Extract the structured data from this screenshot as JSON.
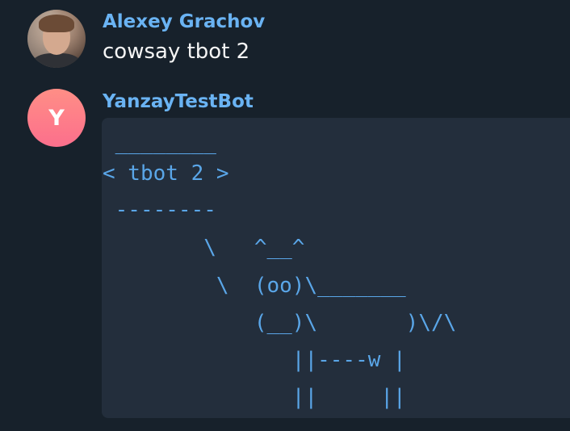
{
  "messages": [
    {
      "sender": "Alexey Grachov",
      "text": "cowsay tbot 2",
      "avatar": {
        "type": "photo",
        "icon": "user-photo-avatar"
      }
    },
    {
      "sender": "YanzayTestBot",
      "avatar": {
        "type": "letter",
        "letter": "Y",
        "colors": [
          "#ff8e86",
          "#fc6f8c"
        ]
      },
      "code_lines": [
        " ________",
        "< tbot 2 >",
        " --------",
        "        \\   ^__^",
        "         \\  (oo)\\_______",
        "            (__)\\       )\\/\\",
        "               ||----w |",
        "               ||     ||"
      ]
    }
  ],
  "colors": {
    "background": "#17212b",
    "sender_name": "#6ab3f3",
    "message_text": "#f5f5f5",
    "code_background": "#232e3c",
    "code_text": "#5aa6e8"
  }
}
